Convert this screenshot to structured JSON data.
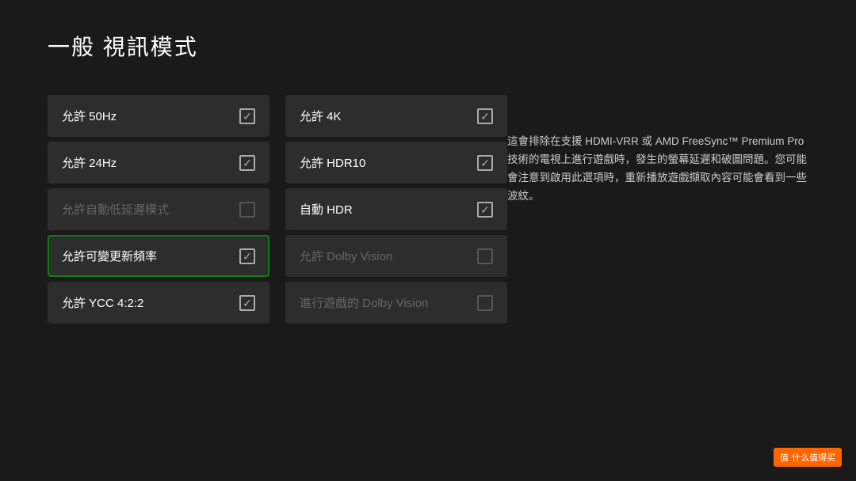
{
  "page": {
    "title": "一般  視訊模式",
    "background_color": "#1a1a1a"
  },
  "info_text": "這會排除在支援 HDMI-VRR 或 AMD FreeSync™ Premium Pro 技術的電視上進行遊戲時，發生的螢幕延遲和破圖問題。您可能會注意到啟用此選項時，重新播放遊戲擷取內容可能會看到一些波紋。",
  "column_left": [
    {
      "id": "allow-50hz",
      "label": "允許 50Hz",
      "checked": true,
      "disabled": false,
      "focused": false
    },
    {
      "id": "allow-24hz",
      "label": "允許 24Hz",
      "checked": true,
      "disabled": false,
      "focused": false
    },
    {
      "id": "allow-auto-low-latency",
      "label": "允許自動低延遲模式",
      "checked": false,
      "disabled": true,
      "focused": false
    },
    {
      "id": "allow-variable-refresh",
      "label": "允許可變更新頻率",
      "checked": true,
      "disabled": false,
      "focused": true
    },
    {
      "id": "allow-ycc422",
      "label": "允許 YCC 4:2:2",
      "checked": true,
      "disabled": false,
      "focused": false
    }
  ],
  "column_right": [
    {
      "id": "allow-4k",
      "label": "允許 4K",
      "checked": true,
      "disabled": false,
      "focused": false
    },
    {
      "id": "allow-hdr10",
      "label": "允許 HDR10",
      "checked": true,
      "disabled": false,
      "focused": false
    },
    {
      "id": "auto-hdr",
      "label": "自動 HDR",
      "checked": true,
      "disabled": false,
      "focused": false
    },
    {
      "id": "allow-dolby-vision",
      "label": "允許 Dolby Vision",
      "checked": false,
      "disabled": true,
      "focused": false
    },
    {
      "id": "gaming-dolby-vision",
      "label": "進行遊戲的 Dolby Vision",
      "checked": false,
      "disabled": true,
      "focused": false
    }
  ],
  "watermark": {
    "icon": "值",
    "text": "什么值得买"
  }
}
